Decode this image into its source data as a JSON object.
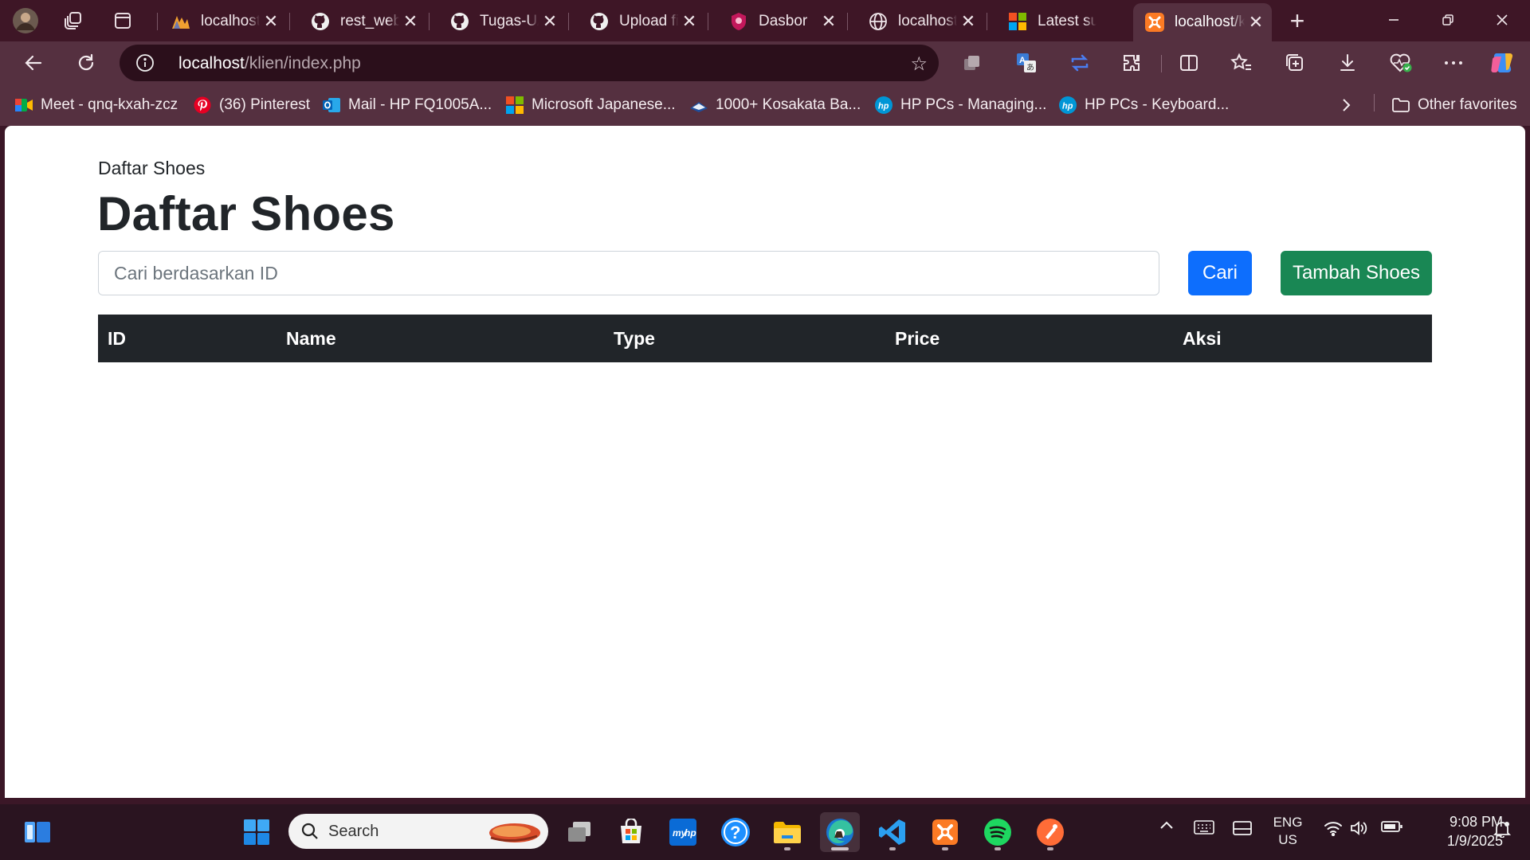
{
  "browser": {
    "tabs": [
      {
        "title": "localhost /",
        "favicon": "phpmyadmin-icon"
      },
      {
        "title": "rest_webse",
        "favicon": "github-icon"
      },
      {
        "title": "Tugas-UAS",
        "favicon": "github-icon"
      },
      {
        "title": "Upload file",
        "favicon": "github-icon"
      },
      {
        "title": "Dasbor",
        "favicon": "dasbor-icon"
      },
      {
        "title": "localhost/r",
        "favicon": "globe-icon"
      },
      {
        "title": "Latest sup",
        "favicon": "microsoft-icon"
      },
      {
        "title": "localhost/k",
        "favicon": "xampp-icon",
        "active": true
      }
    ],
    "new_tab_label": "+",
    "address": {
      "host": "localhost",
      "path": "/klien/index.php"
    },
    "favorites": [
      {
        "label": "Meet - qnq-kxah-zcz",
        "icon": "meet-icon"
      },
      {
        "label": "(36) Pinterest",
        "icon": "pinterest-icon"
      },
      {
        "label": "Mail - HP FQ1005A...",
        "icon": "outlook-icon"
      },
      {
        "label": "Microsoft Japanese...",
        "icon": "microsoft-icon"
      },
      {
        "label": "1000+ Kosakata Ba...",
        "icon": "book-icon"
      },
      {
        "label": "HP PCs - Managing...",
        "icon": "hp-icon"
      },
      {
        "label": "HP PCs - Keyboard...",
        "icon": "hp-icon"
      }
    ],
    "other_favorites": "Other favorites"
  },
  "page": {
    "breadcrumb": "Daftar Shoes",
    "title": "Daftar Shoes",
    "search": {
      "placeholder": "Cari berdasarkan ID",
      "value": ""
    },
    "search_button": "Cari",
    "add_button": "Tambah Shoes",
    "table": {
      "columns": [
        "ID",
        "Name",
        "Type",
        "Price",
        "Aksi"
      ],
      "rows": []
    }
  },
  "taskbar": {
    "search_label": "Search",
    "language": "ENG",
    "region": "US",
    "time": "9:08 PM",
    "date": "1/9/2025"
  },
  "colors": {
    "primary": "#0d6efd",
    "success": "#198754",
    "table_header": "#212529",
    "browser_frame": "#553040"
  }
}
